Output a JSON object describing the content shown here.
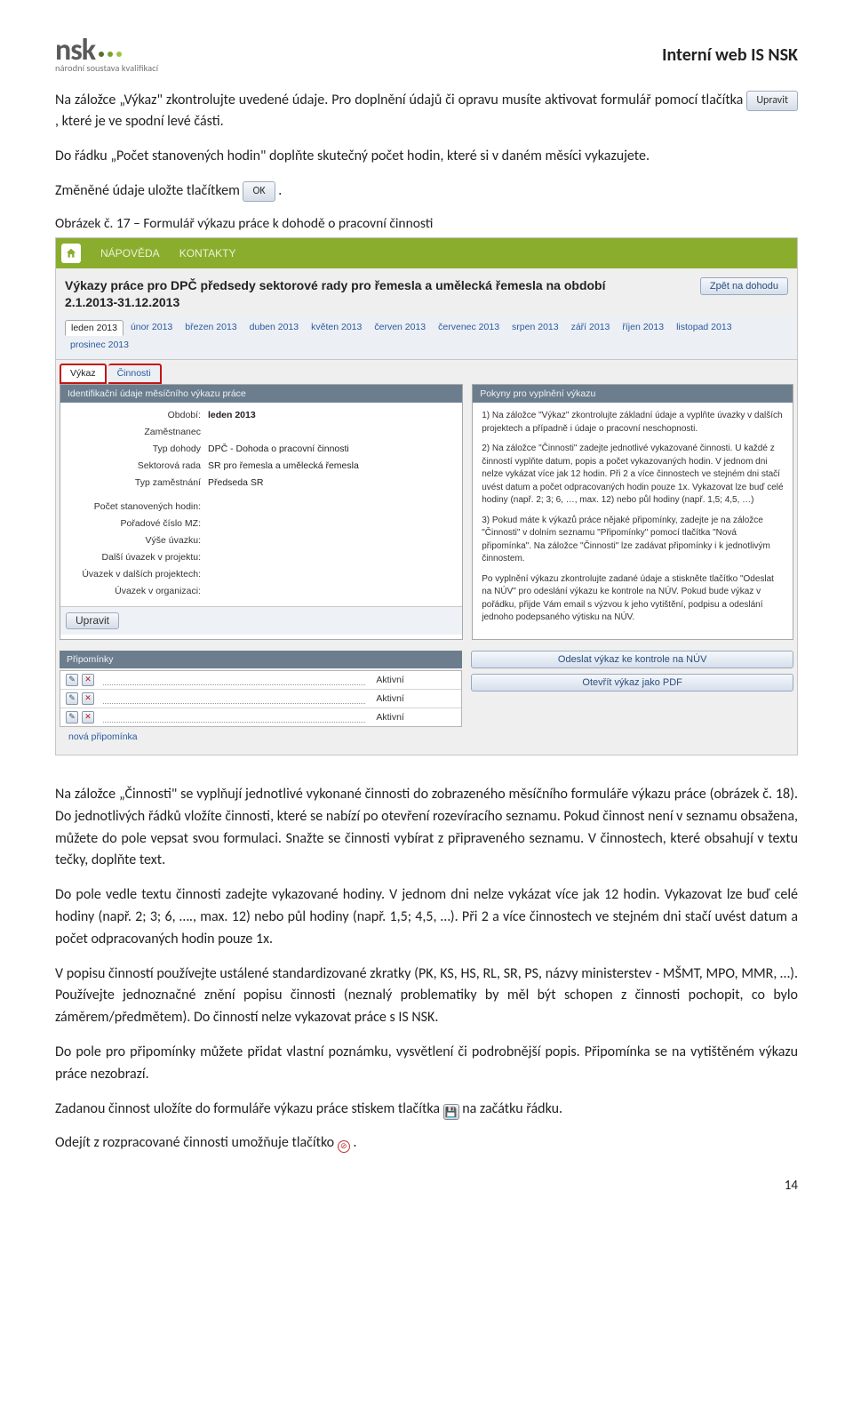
{
  "header": {
    "logo_main": "nsk",
    "logo_sub": "národní soustava kvalifikací",
    "site_title": "Interní web IS NSK"
  },
  "intro": {
    "p1_a": "Na záložce „Výkaz\" zkontrolujte uvedené údaje. Pro doplnění údajů či opravu musíte aktivovat formulář pomocí tlačítka ",
    "btn_upravit": "Upravit",
    "p1_b": ", které je ve spodní levé části.",
    "p2": "Do řádku „Počet stanovených hodin\" doplňte skutečný počet hodin, které si v daném měsíci vykazujete.",
    "p3_a": "Změněné údaje uložte tlačítkem ",
    "btn_ok": "OK",
    "p3_b": ".",
    "caption": "Obrázek č. 17 – Formulář výkazu práce k dohodě o pracovní činnosti"
  },
  "app": {
    "nav": {
      "napoveda": "NÁPOVĚDA",
      "kontakty": "KONTAKTY"
    },
    "title": "Výkazy práce pro DPČ předsedy sektorové rady pro řemesla a umělecká řemesla na období 2.1.2013-31.12.2013",
    "back_btn": "Zpět na dohodu",
    "months": [
      "leden 2013",
      "únor 2013",
      "březen 2013",
      "duben 2013",
      "květen 2013",
      "červen 2013",
      "červenec 2013",
      "srpen 2013",
      "září 2013",
      "říjen 2013",
      "listopad 2013",
      "prosinec 2013"
    ],
    "subtabs": {
      "vykaz": "Výkaz",
      "cinnosti": "Činnosti"
    },
    "left_header": "Identifikační údaje měsíčního výkazu práce",
    "right_header": "Pokyny pro vyplnění výkazu",
    "form": {
      "obdobi_l": "Období:",
      "obdobi_v": "leden 2013",
      "zam_l": "Zaměstnanec",
      "typd_l": "Typ dohody",
      "typd_v": "DPČ - Dohoda o pracovní činnosti",
      "sr_l": "Sektorová rada",
      "sr_v": "SR pro řemesla a umělecká řemesla",
      "tz_l": "Typ zaměstnání",
      "tz_v": "Předseda SR",
      "psh_l": "Počet stanovených hodin:",
      "pcmz_l": "Pořadové číslo MZ:",
      "vu_l": "Výše úvazku:",
      "duk_l": "Další úvazek v projektu:",
      "udp_l": "Úvazek v dalších projektech:",
      "uvo_l": "Úvazek v organizaci:"
    },
    "upravit_btn": "Upravit",
    "prip_header": "Připomínky",
    "prip_status": "Aktivní",
    "new_prip": "nová připomínka",
    "act_send": "Odeslat výkaz ke kontrole na NÚV",
    "act_pdf": "Otevřít výkaz jako PDF",
    "instructions": {
      "i1": "1) Na záložce \"Výkaz\" zkontrolujte základní údaje a vyplňte úvazky v dalších projektech a případně i údaje o pracovní neschopnosti.",
      "i2": "2) Na záložce \"Činnosti\" zadejte jednotlivé vykazované činnosti. U každé z činností vyplňte datum, popis a počet vykazovaných hodin. V jednom dni nelze vykázat více jak 12 hodin. Při 2 a více činnostech ve stejném dni stačí uvést datum a počet odpracovaných hodin pouze 1x. Vykazovat lze buď celé hodiny (např. 2; 3; 6, …, max. 12) nebo půl hodiny (např. 1,5; 4,5, …)",
      "i3": "3) Pokud máte k výkazů práce nějaké připomínky, zadejte je na záložce \"Činnosti\" v dolním seznamu \"Připomínky\" pomocí tlačítka \"Nová připomínka\". Na záložce \"Činnosti\" lze zadávat připomínky i k jednotlivým činnostem.",
      "i4": "Po vyplnění výkazu zkontrolujte zadané údaje a stiskněte tlačítko \"Odeslat na NÚV\" pro odeslání výkazu ke kontrole na NÚV. Pokud bude výkaz v pořádku, přijde Vám email s výzvou k jeho vytištění, podpisu a odeslání jednoho podepsaného výtisku na NÚV."
    }
  },
  "after": {
    "p1": "Na záložce „Činnosti\" se vyplňují jednotlivé vykonané činnosti do zobrazeného měsíčního formuláře výkazu práce (obrázek č. 18). Do jednotlivých řádků vložíte činnosti, které se nabízí po otevření rozevíracího seznamu.  Pokud činnost není v seznamu obsažena, můžete do pole vepsat svou formulaci. Snažte se činnosti vybírat z připraveného seznamu. V činnostech, které obsahují v textu tečky, doplňte text.",
    "p2": "Do pole vedle textu činnosti zadejte vykazované hodiny. V jednom dni nelze vykázat více jak 12 hodin. Vykazovat lze buď celé hodiny (např. 2; 3; 6, …., max. 12) nebo půl hodiny (např. 1,5; 4,5, …). Při 2 a více činnostech ve stejném dni stačí uvést datum a počet odpracovaných hodin pouze 1x.",
    "p3": "V popisu činností používejte ustálené standardizované zkratky (PK, KS, HS, RL, SR, PS, názvy ministerstev - MŠMT, MPO, MMR, …). Používejte jednoznačné znění popisu činnosti (neznalý problematiky by měl být schopen z činnosti pochopit, co bylo záměrem/předmětem). Do činností nelze vykazovat práce s IS NSK.",
    "p4": "Do pole pro připomínky můžete přidat vlastní poznámku, vysvětlení či podrobnější popis. Připomínka se na vytištěném výkazu práce nezobrazí.",
    "p5_a": "Zadanou činnost uložíte do formuláře výkazu práce stiskem tlačítka ",
    "p5_b": " na začátku řádku.",
    "p6_a": "Odejít z rozpracované činnosti umožňuje tlačítko ",
    "p6_b": "."
  },
  "pagenum": "14"
}
